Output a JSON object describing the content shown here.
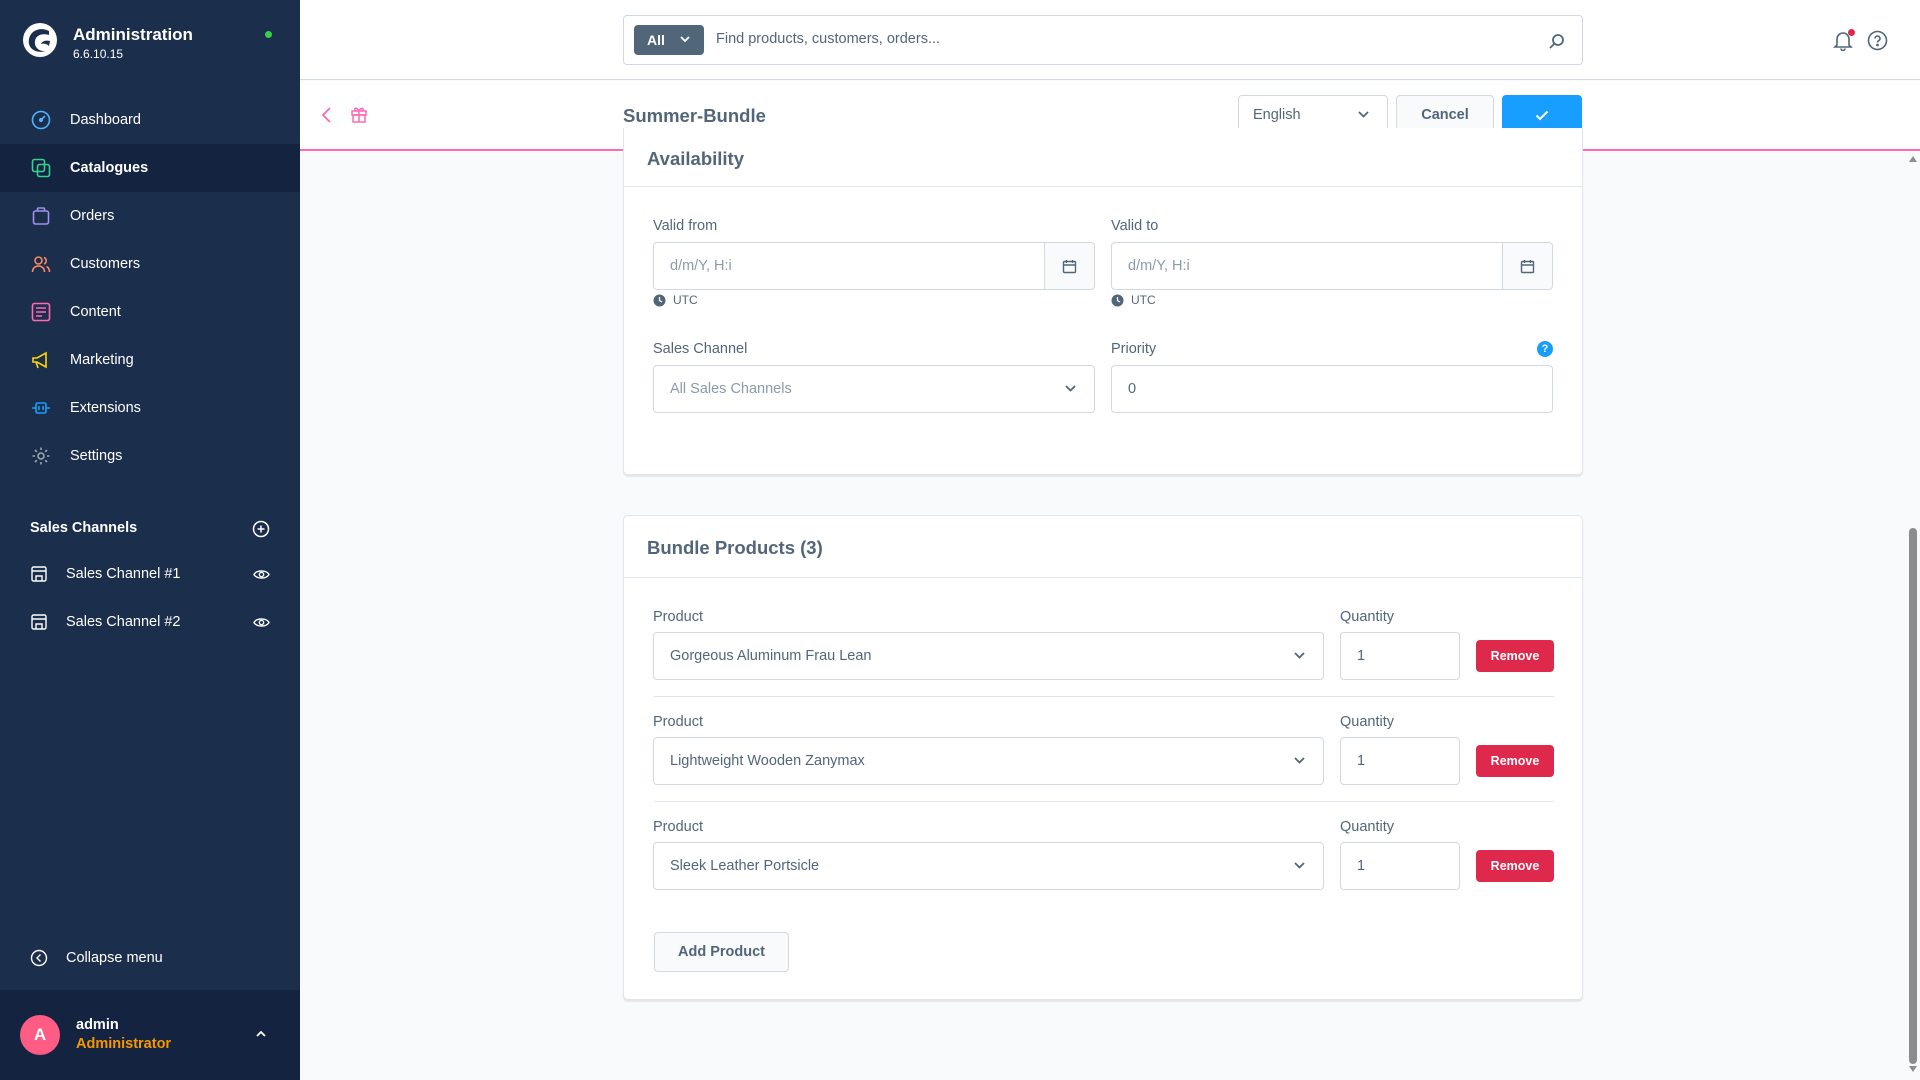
{
  "app": {
    "title": "Administration",
    "version": "6.6.10.15"
  },
  "sidebar": {
    "nav": [
      {
        "label": "Dashboard",
        "icon": "dashboard-icon",
        "active": false
      },
      {
        "label": "Catalogues",
        "icon": "catalogues-icon",
        "active": true
      },
      {
        "label": "Orders",
        "icon": "orders-icon",
        "active": false
      },
      {
        "label": "Customers",
        "icon": "customers-icon",
        "active": false
      },
      {
        "label": "Content",
        "icon": "content-icon",
        "active": false
      },
      {
        "label": "Marketing",
        "icon": "marketing-icon",
        "active": false
      },
      {
        "label": "Extensions",
        "icon": "extensions-icon",
        "active": false
      },
      {
        "label": "Settings",
        "icon": "settings-icon",
        "active": false
      }
    ],
    "sales_channels_title": "Sales Channels",
    "sales_channels": [
      {
        "label": "Sales Channel #1"
      },
      {
        "label": "Sales Channel #2"
      }
    ],
    "collapse_label": "Collapse menu",
    "user": {
      "initial": "A",
      "name": "admin",
      "role": "Administrator"
    }
  },
  "topbar": {
    "search_scope": "All",
    "search_placeholder": "Find products, customers, orders..."
  },
  "page": {
    "title": "Summer-Bundle",
    "language": "English",
    "cancel_label": "Cancel"
  },
  "availability": {
    "title": "Availability",
    "valid_from_label": "Valid from",
    "valid_from_placeholder": "d/m/Y, H:i",
    "valid_to_label": "Valid to",
    "valid_to_placeholder": "d/m/Y, H:i",
    "timezone": "UTC",
    "sales_channel_label": "Sales Channel",
    "sales_channel_value": "All Sales Channels",
    "priority_label": "Priority",
    "priority_value": "0",
    "help_glyph": "?"
  },
  "bundle": {
    "title": "Bundle Products (3)",
    "product_label": "Product",
    "quantity_label": "Quantity",
    "remove_label": "Remove",
    "add_label": "Add Product",
    "items": [
      {
        "product": "Gorgeous Aluminum Frau Lean",
        "quantity": "1"
      },
      {
        "product": "Lightweight Wooden Zanymax",
        "quantity": "1"
      },
      {
        "product": "Sleek Leather Portsicle",
        "quantity": "1"
      }
    ]
  },
  "colors": {
    "sidebar_bg": "#1b2e4b",
    "accent": "#189eff",
    "danger": "#de294c",
    "header_line": "#ff68b4",
    "role": "#f79700"
  }
}
